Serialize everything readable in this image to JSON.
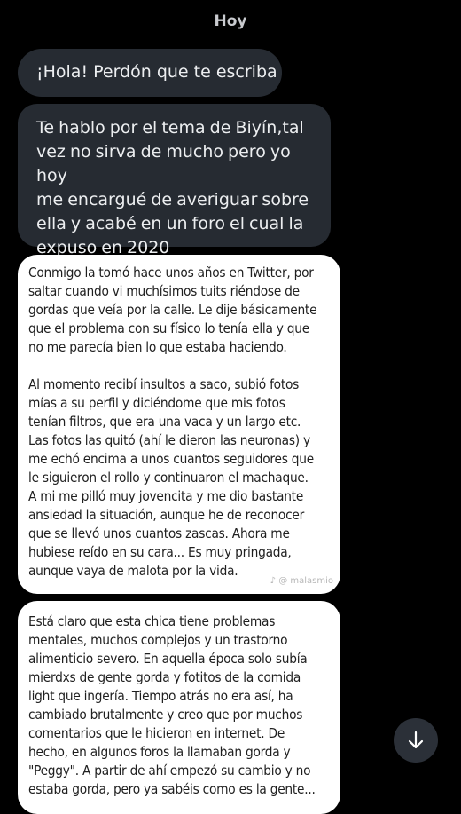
{
  "header": {
    "date_label": "Hoy"
  },
  "messages": {
    "m1": "¡Hola! Perdón que te escriba",
    "m2": "Te hablo por el tema de Biyín,tal\nvez no sirva de mucho pero yo hoy\nme encargué de averiguar sobre\nella y acabé en un foro el cual la\nexpuso en 2020"
  },
  "cards": {
    "card1": {
      "p1": "Conmigo la tomó hace unos años en Twitter, por\nsaltar cuando vi muchísimos tuits riéndose de\ngordas que veía por la calle. Le dije básicamente\nque el problema con su físico lo tenía ella y que\nno me parecía bien lo que estaba haciendo.",
      "p2": "Al momento recibí insultos a saco, subió fotos\nmías a su perfil y diciéndome que mis fotos\ntenían filtros, que era una vaca y un largo etc.\nLas fotos las quitó (ahí le dieron las neuronas) y\nme echó encima a unos cuantos seguidores que\nle siguieron el rollo y continuaron el machaque.\nA mi me pilló muy jovencita y me dio bastante\nansiedad la situación, aunque he de reconocer\nque se llevó unos cuantos zascas. Ahora me\nhubiese reído en su cara... Es muy pringada,\naunque vaya de malota por la vida.",
      "watermark": "@ malasmio"
    },
    "card2": {
      "p1": "Está claro que esta chica tiene problemas\nmentales, muchos complejos y un trastorno\nalimenticio severo. En aquella época solo subía\nmierdxs de gente gorda y fotitos de la comida\nlight que ingería. Tiempo atrás no era así, ha\ncambiado brutalmente y creo que por muchos\ncomentarios que le hicieron en internet. De\nhecho, en algunos foros la llamaban gorda y\n\"Peggy\". A partir de ahí empezó su cambio y no\nestaba gorda, pero ya sabéis como es la gente..."
    }
  },
  "scroll_button": {
    "icon": "arrow-down-icon"
  }
}
